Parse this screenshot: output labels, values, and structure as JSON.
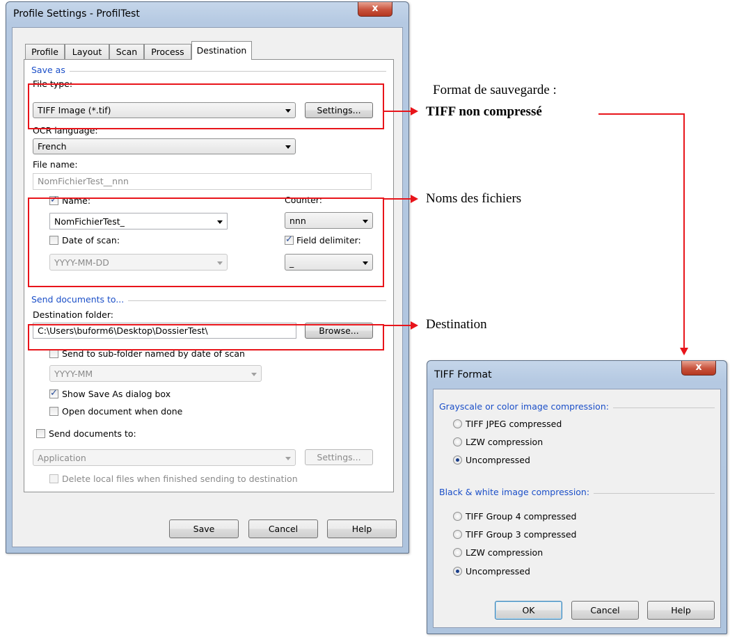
{
  "profile_window": {
    "title": "Profile Settings - ProfilTest",
    "close_symbol": "x",
    "tabs": [
      "Profile",
      "Layout",
      "Scan",
      "Process",
      "Destination"
    ],
    "active_tab": "Destination",
    "save_as": {
      "group_label": "Save as",
      "file_type_label": "File type:",
      "file_type_value": "TIFF Image (*.tif)",
      "settings_button": "Settings...",
      "ocr_language_label": "OCR language:",
      "ocr_language_value": "French",
      "file_name_label": "File name:",
      "file_name_value": "NomFichierTest__nnn",
      "name_checkbox_label": "Name:",
      "name_checked": true,
      "name_value": "NomFichierTest_",
      "counter_label": "Counter:",
      "counter_value": "nnn",
      "date_of_scan_label": "Date of scan:",
      "date_of_scan_checked": false,
      "date_format_value": "YYYY-MM-DD",
      "field_delimiter_label": "Field delimiter:",
      "field_delimiter_checked": true,
      "field_delimiter_value": "_"
    },
    "send_documents": {
      "group_label": "Send documents to...",
      "destination_folder_label": "Destination folder:",
      "destination_folder_value": "C:\\Users\\buform6\\Desktop\\DossierTest\\",
      "browse_button": "Browse...",
      "subfolder_label": "Send to sub-folder named by date of scan",
      "subfolder_checked": false,
      "subfolder_format_value": "YYYY-MM",
      "show_save_as_label": "Show Save As dialog box",
      "show_save_as_checked": true,
      "open_document_label": "Open document when done",
      "open_document_checked": false,
      "send_documents_to_label": "Send documents to:",
      "send_documents_to_checked": false,
      "application_value": "Application",
      "app_settings_button": "Settings...",
      "delete_local_label": "Delete local files when finished sending to destination",
      "delete_local_checked": false
    },
    "buttons": {
      "save": "Save",
      "cancel": "Cancel",
      "help": "Help"
    }
  },
  "tiff_window": {
    "title": "TIFF Format",
    "close_symbol": "x",
    "grayscale_group_label": "Grayscale or color image compression:",
    "grayscale_options": [
      {
        "label": "TIFF JPEG compressed",
        "selected": false
      },
      {
        "label": "LZW compression",
        "selected": false
      },
      {
        "label": "Uncompressed",
        "selected": true
      }
    ],
    "bw_group_label": "Black & white image compression:",
    "bw_options": [
      {
        "label": "TIFF Group 4 compressed",
        "selected": false
      },
      {
        "label": "TIFF Group 3 compressed",
        "selected": false
      },
      {
        "label": "LZW compression",
        "selected": false
      },
      {
        "label": "Uncompressed",
        "selected": true
      }
    ],
    "buttons": {
      "ok": "OK",
      "cancel": "Cancel",
      "help": "Help"
    }
  },
  "annotations": {
    "format_line1": "Format de sauvegarde :",
    "format_line2": "TIFF non compressé",
    "file_names": "Noms des fichiers",
    "destination": "Destination",
    "highlight_color": "#e8141a"
  }
}
